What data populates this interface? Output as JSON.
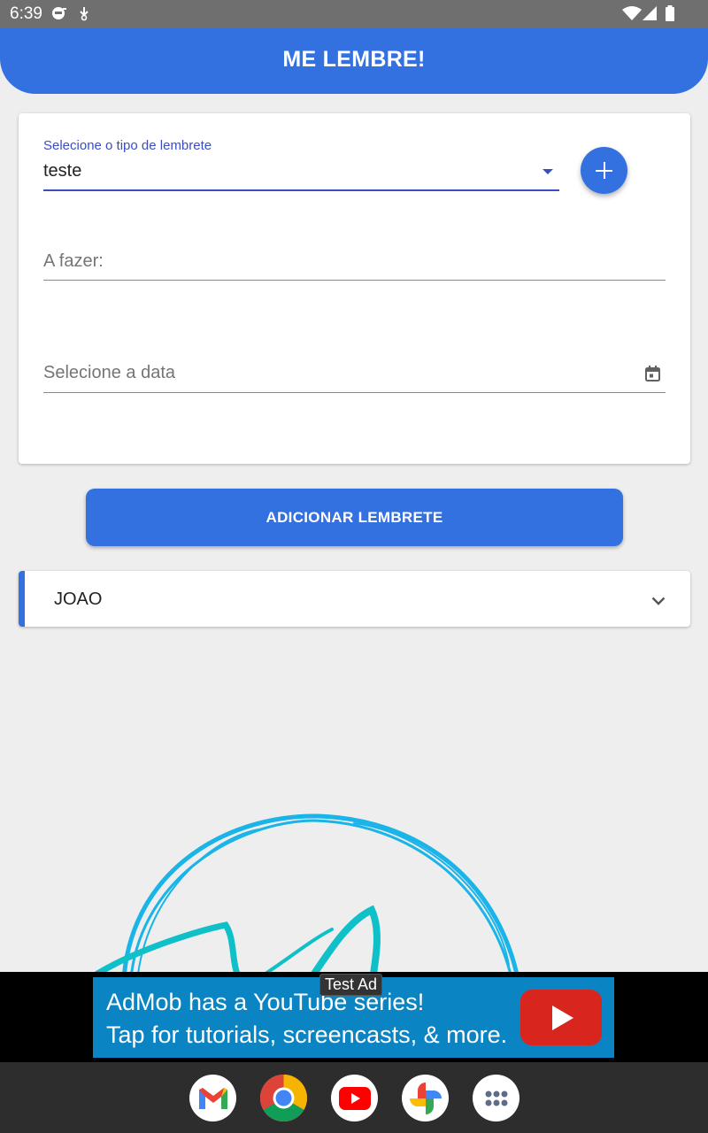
{
  "status_bar": {
    "time": "6:39"
  },
  "app_bar": {
    "title": "ME LEMBRE!"
  },
  "form": {
    "type_select": {
      "label": "Selecione o tipo de lembrete",
      "value": "teste"
    },
    "todo": {
      "placeholder": "A fazer:",
      "value": ""
    },
    "date": {
      "placeholder": "Selecione a data"
    }
  },
  "actions": {
    "add_reminder": "ADICIONAR LEMBRETE"
  },
  "reminders": [
    {
      "title": "JOAO"
    }
  ],
  "ad": {
    "tag": "Test Ad",
    "line1": "AdMob has a YouTube series!",
    "line2": "Tap for tutorials, screencasts, & more."
  },
  "dock": [
    "gmail-icon",
    "chrome-icon",
    "youtube-icon",
    "photos-icon",
    "app-drawer-icon"
  ],
  "colors": {
    "primary": "#3370e0",
    "select_accent": "#3a4ec2",
    "background": "#eeeeee",
    "ad_banner": "#0a84c3"
  }
}
